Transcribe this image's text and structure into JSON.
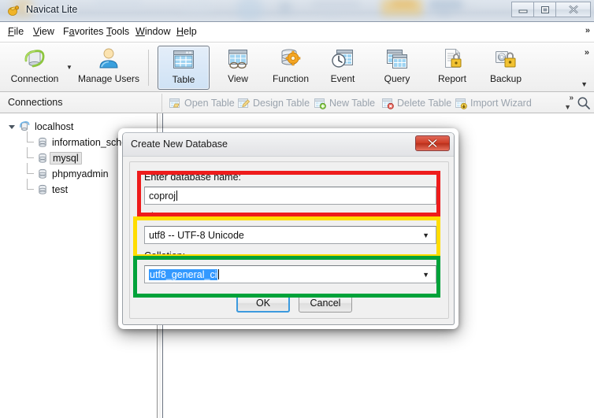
{
  "window": {
    "title": "Navicat Lite",
    "app_icon": "navicat-logo-icon",
    "controls": {
      "minimize": "minimize-icon",
      "restore": "restore-icon",
      "close": "close-icon"
    }
  },
  "menu": {
    "items": [
      {
        "label": "File",
        "accel": "F"
      },
      {
        "label": "View",
        "accel": "V"
      },
      {
        "label": "Favorites",
        "accel": "a"
      },
      {
        "label": "Tools",
        "accel": "T"
      },
      {
        "label": "Window",
        "accel": "W"
      },
      {
        "label": "Help",
        "accel": "H"
      }
    ],
    "overflow": "»"
  },
  "toolbar": {
    "items": [
      {
        "label": "Connection",
        "icon": "connection-icon",
        "active": false,
        "dropdown": true
      },
      {
        "label": "Manage Users",
        "icon": "manage-users-icon",
        "active": false,
        "dropdown": false
      },
      {
        "label": "Table",
        "icon": "table-icon",
        "active": true,
        "dropdown": false
      },
      {
        "label": "View",
        "icon": "view-icon",
        "active": false,
        "dropdown": false
      },
      {
        "label": "Function",
        "icon": "function-icon",
        "active": false,
        "dropdown": false
      },
      {
        "label": "Event",
        "icon": "event-icon",
        "active": false,
        "dropdown": false
      },
      {
        "label": "Query",
        "icon": "query-icon",
        "active": false,
        "dropdown": false
      },
      {
        "label": "Report",
        "icon": "report-icon",
        "active": false,
        "dropdown": false
      },
      {
        "label": "Backup",
        "icon": "backup-icon",
        "active": false,
        "dropdown": false
      }
    ],
    "overflow_chevron": "»",
    "overflow_arrow": "▼"
  },
  "strip": {
    "title": "Connections",
    "buttons": [
      {
        "label": "Open Table",
        "icon": "open-table-icon",
        "enabled": false
      },
      {
        "label": "Design Table",
        "icon": "design-table-icon",
        "enabled": false
      },
      {
        "label": "New Table",
        "icon": "new-table-icon",
        "enabled": false
      },
      {
        "label": "Delete Table",
        "icon": "delete-table-icon",
        "enabled": false
      },
      {
        "label": "Import Wizard",
        "icon": "import-wizard-icon",
        "enabled": false
      }
    ],
    "overflow_chevron": "»",
    "overflow_arrow": "▼",
    "search_icon": "search-icon"
  },
  "tree": {
    "root": {
      "label": "localhost",
      "icon": "connection-host-icon",
      "expanded": true
    },
    "children": [
      {
        "label": "information_schema",
        "icon": "database-icon",
        "selected": false
      },
      {
        "label": "mysql",
        "icon": "database-icon",
        "selected": true
      },
      {
        "label": "phpmyadmin",
        "icon": "database-icon",
        "selected": false
      },
      {
        "label": "test",
        "icon": "database-icon",
        "selected": false
      }
    ]
  },
  "dialog": {
    "title": "Create New Database",
    "close_icon": "close-icon",
    "fields": {
      "name": {
        "label": "Enter database name:",
        "value": "coproj",
        "placeholder": ""
      },
      "charset": {
        "label": "Character set:",
        "value": "utf8 -- UTF-8 Unicode",
        "arrow": "▼"
      },
      "collation": {
        "label": "Collation:",
        "value": "utf8_general_ci",
        "selected": true,
        "arrow": "▼"
      }
    },
    "buttons": {
      "ok": "OK",
      "cancel": "Cancel"
    }
  },
  "annotations": [
    {
      "name": "database-name-highlight",
      "color": "#ee1c1c"
    },
    {
      "name": "character-set-highlight",
      "color": "#ffdd00"
    },
    {
      "name": "collation-highlight",
      "color": "#00a23a"
    }
  ]
}
